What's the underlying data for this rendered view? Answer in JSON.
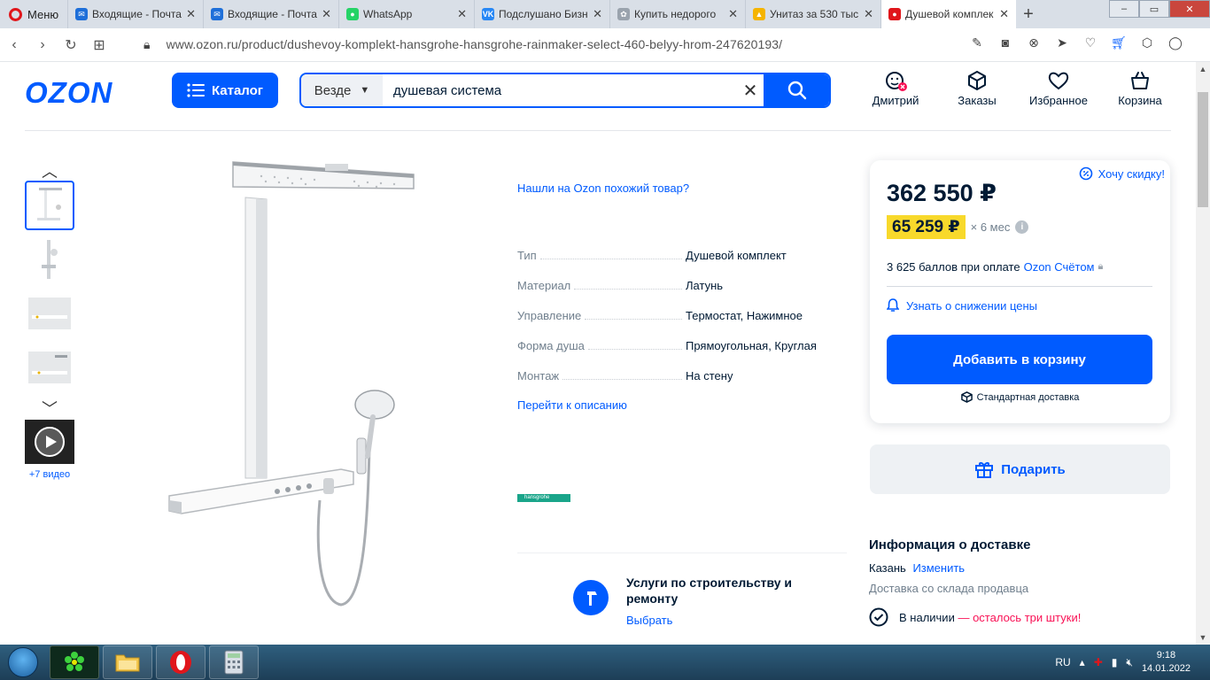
{
  "browser": {
    "menu_label": "Меню",
    "tabs": [
      {
        "title": "Входящие - Почта",
        "fav_color": "#1e6fd9",
        "fav_glyph": "✉"
      },
      {
        "title": "Входящие - Почта",
        "fav_color": "#1e6fd9",
        "fav_glyph": "✉"
      },
      {
        "title": "WhatsApp",
        "fav_color": "#25d366",
        "fav_glyph": "●"
      },
      {
        "title": "Подслушано Бизн",
        "fav_color": "#2787f5",
        "fav_glyph": "VK"
      },
      {
        "title": "Купить недорого",
        "fav_color": "#9aa3ad",
        "fav_glyph": "✿"
      },
      {
        "title": "Унитаз за 530 тыс",
        "fav_color": "#f5b400",
        "fav_glyph": "▲"
      },
      {
        "title": "Душевой комплек",
        "fav_color": "#e0161b",
        "fav_glyph": "●"
      }
    ],
    "url": "www.ozon.ru/product/dushevoy-komplekt-hansgrohe-hansgrohe-rainmaker-select-460-belyy-hrom-247620193/"
  },
  "header": {
    "logo": "OZON",
    "catalog_label": "Каталог",
    "search_scope": "Везде",
    "search_value": "душевая система",
    "icons": [
      {
        "label": "Дмитрий",
        "icon": "user-icon"
      },
      {
        "label": "Заказы",
        "icon": "box-icon"
      },
      {
        "label": "Избранное",
        "icon": "heart-icon"
      },
      {
        "label": "Корзина",
        "icon": "bag-icon"
      }
    ]
  },
  "gallery": {
    "more_videos": "+7 видео"
  },
  "product": {
    "similar_link": "Нашли на Ozon похожий товар?",
    "attributes": [
      {
        "key": "Тип",
        "value": "Душевой комплект"
      },
      {
        "key": "Материал",
        "value": "Латунь"
      },
      {
        "key": "Управление",
        "value": "Термостат, Нажимное"
      },
      {
        "key": "Форма душа",
        "value": "Прямоугольная, Круглая"
      },
      {
        "key": "Монтаж",
        "value": "На стену"
      }
    ],
    "description_link": "Перейти к описанию",
    "brand": "hansgrohe",
    "services_title": "Услуги по строительству и ремонту",
    "services_link": "Выбрать"
  },
  "price_card": {
    "discount_link": "Хочу скидку!",
    "price": "362 550 ₽",
    "installment_amount": "65 259 ₽",
    "installment_term": "× 6 мес",
    "bonus_text": "3 625 баллов при оплате",
    "bonus_link": "Ozon Счётом",
    "notify_link": "Узнать о снижении цены",
    "add_to_cart": "Добавить в корзину",
    "delivery_type": "Стандартная доставка",
    "gift_label": "Подарить"
  },
  "delivery": {
    "title": "Информация о доставке",
    "city": "Казань",
    "change_link": "Изменить",
    "warehouse": "Доставка со склада продавца",
    "stock": "В наличии",
    "stock_warning": "— осталось три штуки!"
  },
  "taskbar": {
    "lang": "RU",
    "time": "9:18",
    "date": "14.01.2022"
  }
}
